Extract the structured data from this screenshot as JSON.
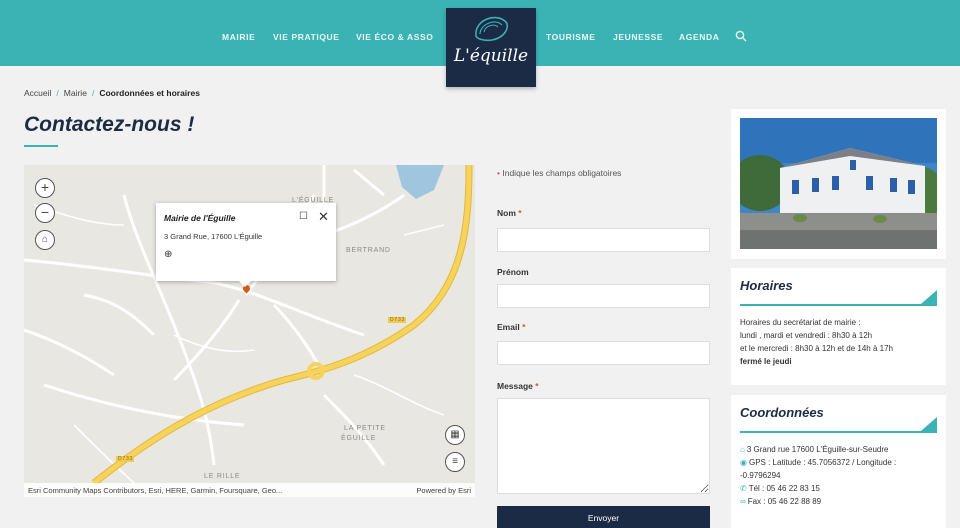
{
  "header": {
    "nav_left": [
      "MAIRIE",
      "VIE PRATIQUE",
      "VIE ÉCO & ASSO"
    ],
    "nav_right": [
      "TOURISME",
      "JEUNESSE",
      "AGENDA"
    ],
    "logo_text": "L'équille",
    "search_icon": "search-icon"
  },
  "breadcrumb": {
    "items": [
      "Accueil",
      "Mairie",
      "Coordonnées et horaires"
    ],
    "separator": "/"
  },
  "page_title": "Contactez-nous !",
  "map": {
    "popup_title": "Mairie de l'Éguille",
    "popup_address": "3 Grand Rue, 17600 L'Éguille",
    "labels": [
      "L'ÉGUILLE",
      "BERTRAND",
      "LA PETITE",
      "ÉGUILLE",
      "LE RILLE"
    ],
    "attribution": "Esri Community Maps Contributors, Esri, HERE, Garmin, Foursquare, Geo...",
    "powered_by": "Powered by Esri",
    "road_labels": [
      "D733",
      "D733"
    ],
    "controls": [
      "zoom-in",
      "zoom-out",
      "home",
      "basemap",
      "legend"
    ]
  },
  "form": {
    "required_note": "Indique les champs obligatoires",
    "fields": [
      {
        "label": "Nom",
        "required": true,
        "value": ""
      },
      {
        "label": "Prénom",
        "required": false,
        "value": ""
      },
      {
        "label": "Email",
        "required": true,
        "value": ""
      },
      {
        "label": "Message",
        "required": true,
        "value": ""
      }
    ],
    "submit_label": "Envoyer"
  },
  "sidebar": {
    "horaires": {
      "title": "Horaires",
      "lines": [
        "Horaires du secrétariat de mairie :",
        "lundi , mardi et vendredi : 8h30 à 12h",
        "et le mercredi : 8h30 à 12h et de 14h à 17h",
        "fermé le jeudi"
      ]
    },
    "coordonnees": {
      "title": "Coordonnées",
      "address": "3 Grand rue 17600 L'Éguille-sur-Seudre",
      "gps_line1": "GPS : Latitude : 45.7056372 / Longitude :",
      "gps_line2": "-0.9796294",
      "tel": "Tél : 05 46 22 83 15",
      "fax": "Fax : 05 46 22 88 89"
    }
  },
  "colors": {
    "teal": "#3bb2b4",
    "navy": "#1b2b45",
    "road_yellow": "#f2c94c",
    "required_star": "#e05033"
  }
}
